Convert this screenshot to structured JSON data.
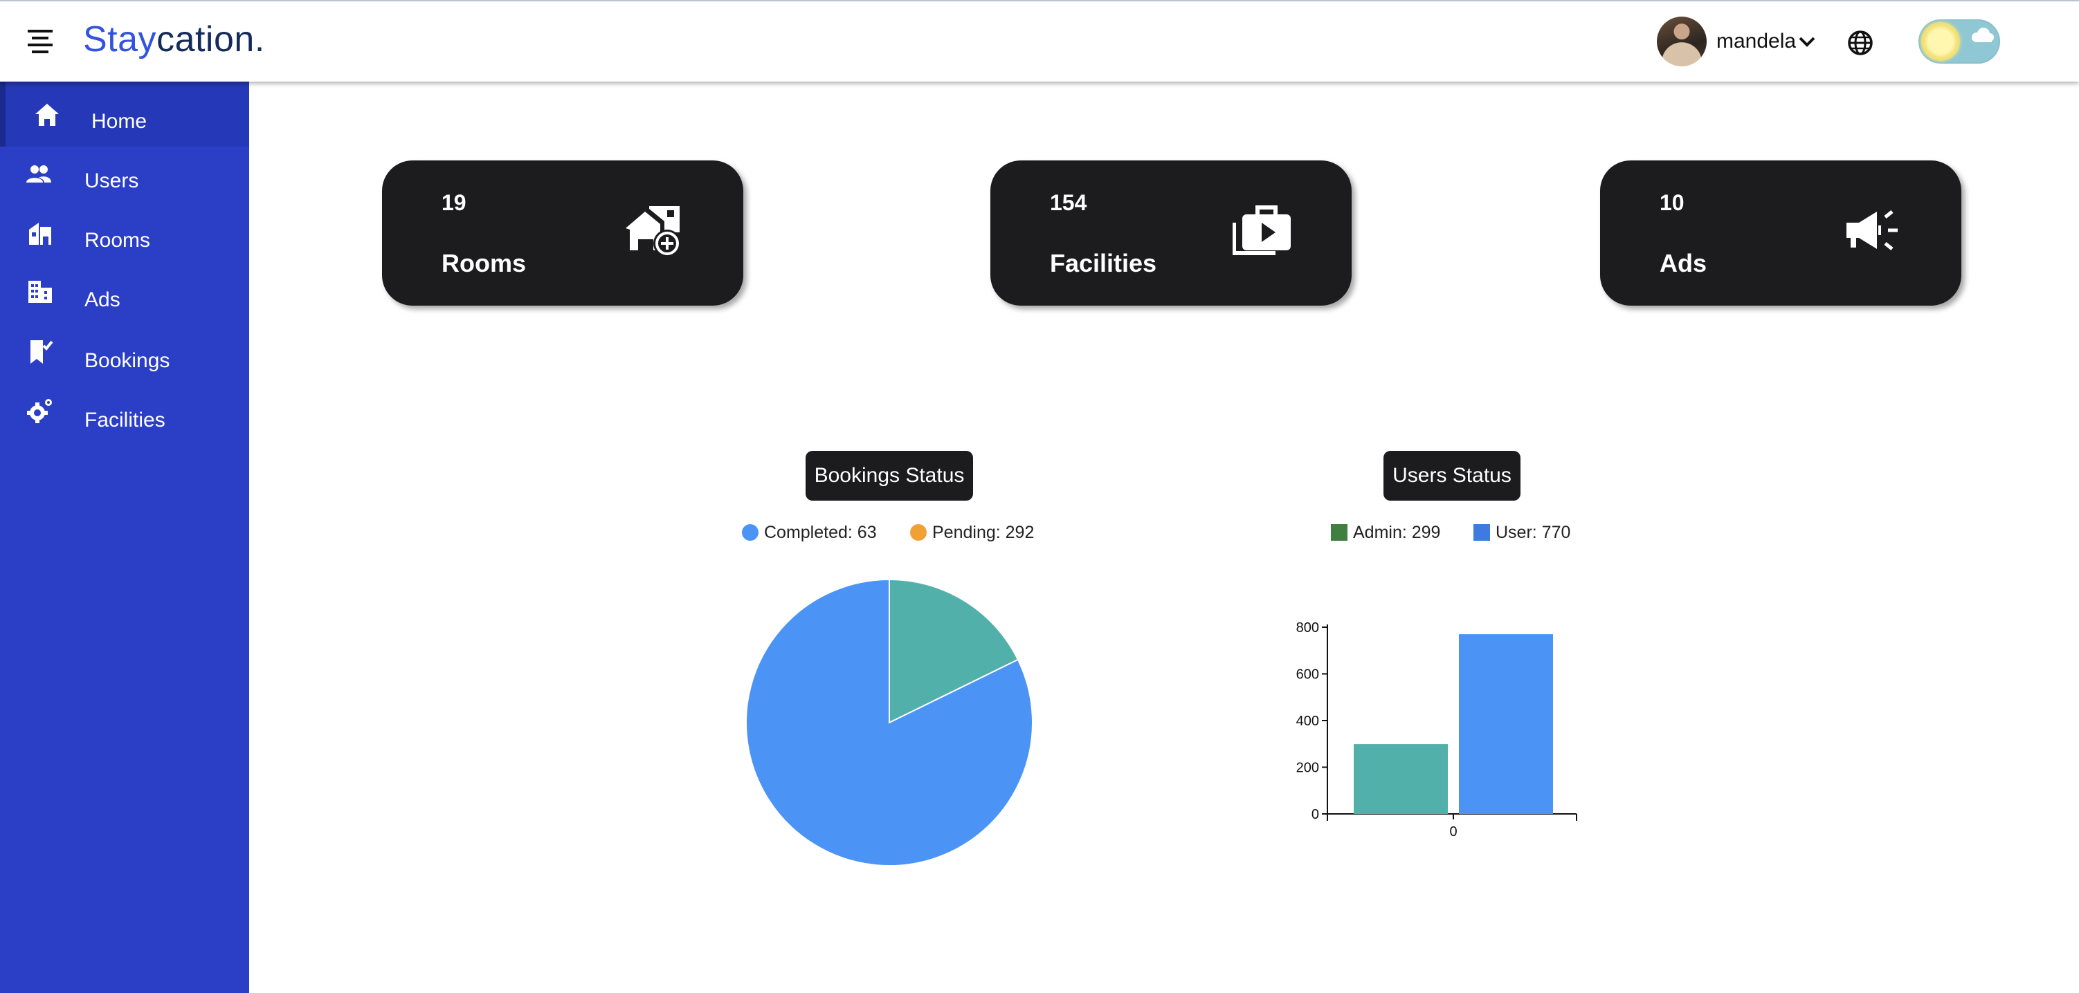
{
  "brand": {
    "part1": "Stay",
    "part2": "cation."
  },
  "header": {
    "username": "mandela"
  },
  "sidebar": {
    "items": [
      {
        "label": "Home",
        "icon": "home-icon",
        "active": true
      },
      {
        "label": "Users",
        "icon": "users-icon"
      },
      {
        "label": "Rooms",
        "icon": "rooms-icon"
      },
      {
        "label": "Ads",
        "icon": "ads-icon"
      },
      {
        "label": "Bookings",
        "icon": "bookings-icon"
      },
      {
        "label": "Facilities",
        "icon": "facilities-icon"
      }
    ]
  },
  "stats": [
    {
      "value": "19",
      "label": "Rooms",
      "icon": "house-add-icon"
    },
    {
      "value": "154",
      "label": "Facilities",
      "icon": "briefcase-play-icon"
    },
    {
      "value": "10",
      "label": "Ads",
      "icon": "megaphone-icon"
    }
  ],
  "colors": {
    "sidebar": "#2a3ec6",
    "card": "#1c1c1f",
    "brand_blue": "#3252df",
    "brand_navy": "#152c5b"
  },
  "chart_data": [
    {
      "type": "pie",
      "title": "Bookings Status",
      "legend": [
        {
          "label": "Completed: 63",
          "color": "#4b93f5"
        },
        {
          "label": "Pending: 292",
          "color": "#f0a035"
        }
      ],
      "slices": [
        {
          "name": "Completed",
          "value": 63,
          "color": "#52b0ab"
        },
        {
          "name": "Pending",
          "value": 292,
          "color": "#4b93f5"
        }
      ]
    },
    {
      "type": "bar",
      "title": "Users Status",
      "legend": [
        {
          "label": "Admin: 299",
          "color": "#3f7f3f"
        },
        {
          "label": "User: 770",
          "color": "#3f7ae0"
        }
      ],
      "categories": [
        "0"
      ],
      "series": [
        {
          "name": "Admin",
          "values": [
            299
          ],
          "color": "#52b0ab"
        },
        {
          "name": "User",
          "values": [
            770
          ],
          "color": "#4b93f5"
        }
      ],
      "ylim": [
        0,
        800
      ],
      "yticks": [
        0,
        200,
        400,
        600,
        800
      ]
    }
  ]
}
